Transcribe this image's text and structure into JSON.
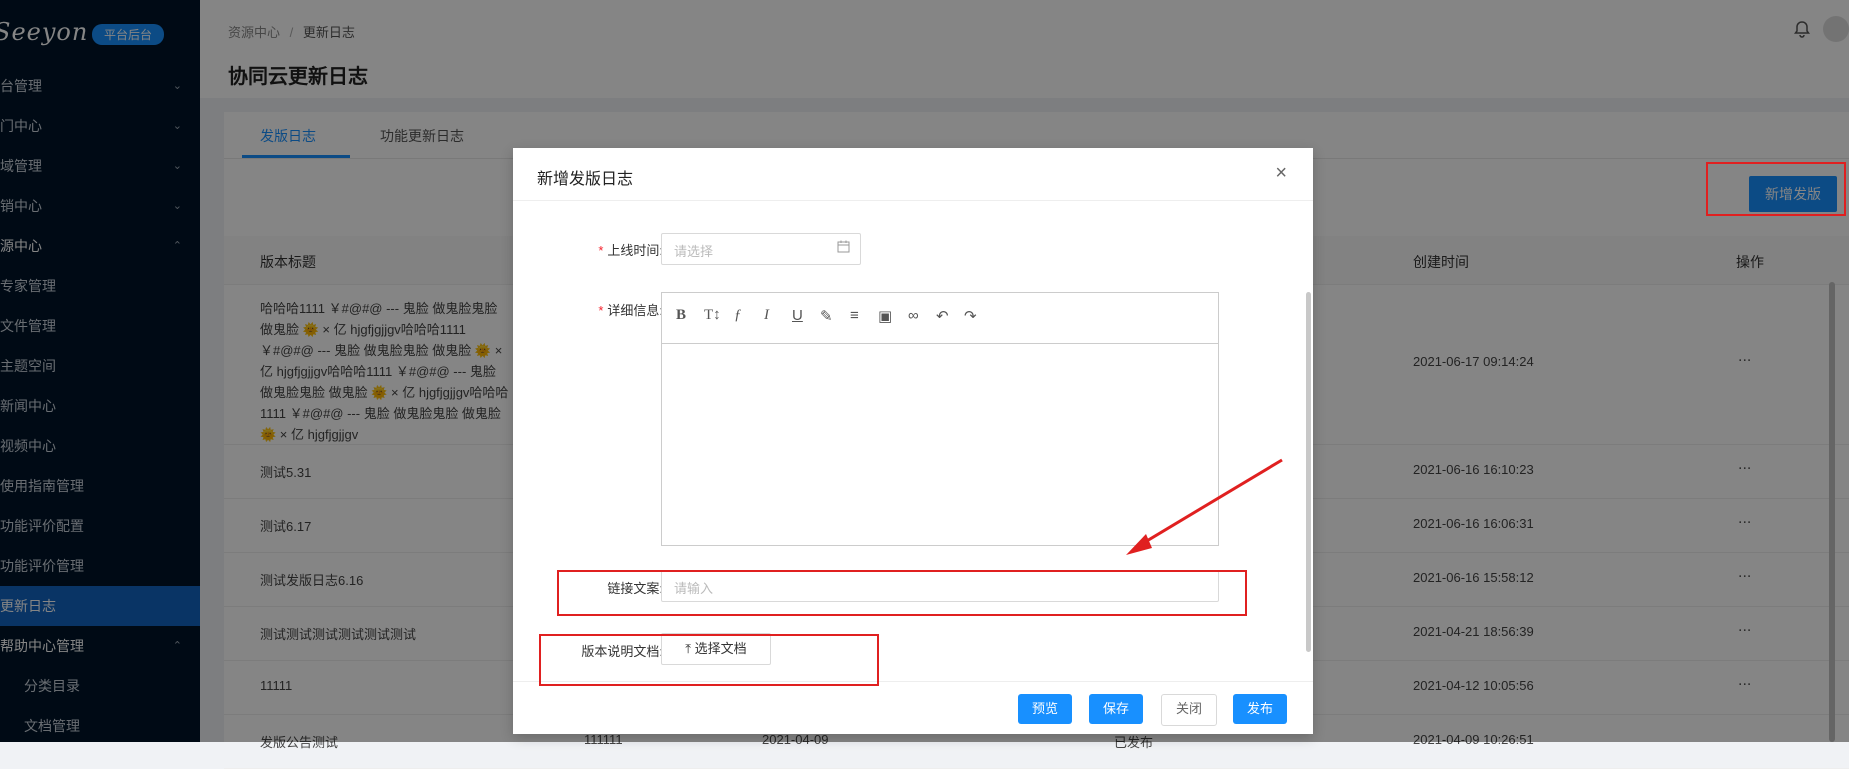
{
  "sidebar": {
    "logo": "Seeyon",
    "badge": "平台后台",
    "items": [
      {
        "label": "台管理",
        "chev": "⌄"
      },
      {
        "label": "门中心",
        "chev": "⌄"
      },
      {
        "label": "域管理",
        "chev": "⌄"
      },
      {
        "label": "销中心",
        "chev": "⌄"
      },
      {
        "label": "源中心",
        "chev": "⌃"
      },
      {
        "label": "专家管理"
      },
      {
        "label": "文件管理"
      },
      {
        "label": "主题空间"
      },
      {
        "label": "新闻中心"
      },
      {
        "label": "视频中心"
      },
      {
        "label": "使用指南管理"
      },
      {
        "label": "功能评价配置"
      },
      {
        "label": "功能评价管理"
      },
      {
        "label": "更新日志"
      },
      {
        "label": "帮助中心管理",
        "chev": "⌃"
      },
      {
        "label": "分类目录"
      },
      {
        "label": "文档管理"
      }
    ]
  },
  "header": {
    "breadcrumb_root": "资源中心",
    "breadcrumb_sep": "/",
    "breadcrumb_current": "更新日志",
    "title": "协同云更新日志"
  },
  "tabs": [
    "发版日志",
    "功能更新日志"
  ],
  "add_button": "新增发版",
  "table": {
    "headers": {
      "title": "版本标题",
      "created": "创建时间",
      "ops": "操作"
    },
    "first_row_title": "哈哈哈1111 ￥#@#@ --- 鬼脸 做鬼脸鬼脸 做鬼脸 🌞 × 亿 hjgfjgjjgv哈哈哈1111 ￥#@#@ --- 鬼脸 做鬼脸鬼脸 做鬼脸 🌞 × 亿 hjgfjgjjgv哈哈哈1111 ￥#@#@ --- 鬼脸 做鬼脸鬼脸 做鬼脸 🌞 × 亿 hjgfjgjjgv哈哈哈1111 ￥#@#@ --- 鬼脸 做鬼脸鬼脸 做鬼脸 🌞 × 亿 hjgfjgjjgv",
    "rows": [
      {
        "created": "2021-06-17 09:14:24",
        "ops": "..."
      },
      {
        "title": "测试5.31",
        "created": "2021-06-16 16:10:23",
        "ops": "..."
      },
      {
        "title": "测试6.17",
        "created": "2021-06-16 16:06:31",
        "ops": "..."
      },
      {
        "title": "测试发版日志6.16",
        "created": "2021-06-16 15:58:12",
        "ops": "..."
      },
      {
        "title": "测试测试测试测试测试测试",
        "created": "2021-04-21 18:56:39",
        "ops": "..."
      },
      {
        "title": "11111",
        "created": "2021-04-12 10:05:56",
        "ops": "..."
      },
      {
        "title": "发版公告测试",
        "col2": "111111",
        "col3": "2021-04-09",
        "col4": "已发布",
        "created": "2021-04-09 10:26:51",
        "ops": "..."
      }
    ]
  },
  "modal": {
    "title": "新增发版日志",
    "close": "×",
    "fields": {
      "online_time_label": "上线时间:",
      "online_time_placeholder": "请选择",
      "detail_label": "详细信息:",
      "link_label": "链接文案:",
      "link_placeholder": "请输入",
      "doc_label": "版本说明文档:",
      "doc_button": "选择文档"
    },
    "required_mark": "*",
    "toolbar_icons": [
      "bold-icon",
      "font-size-icon",
      "font-style-icon",
      "italic-icon",
      "underline-icon",
      "highlight-icon",
      "align-icon",
      "image-icon",
      "link-icon",
      "undo-icon",
      "redo-icon"
    ],
    "footer": {
      "preview": "预览",
      "save": "保存",
      "close": "关闭",
      "publish": "发布"
    }
  },
  "colors": {
    "primary": "#1890ff",
    "sidebar": "#001529",
    "highlight_box": "#e02020"
  }
}
